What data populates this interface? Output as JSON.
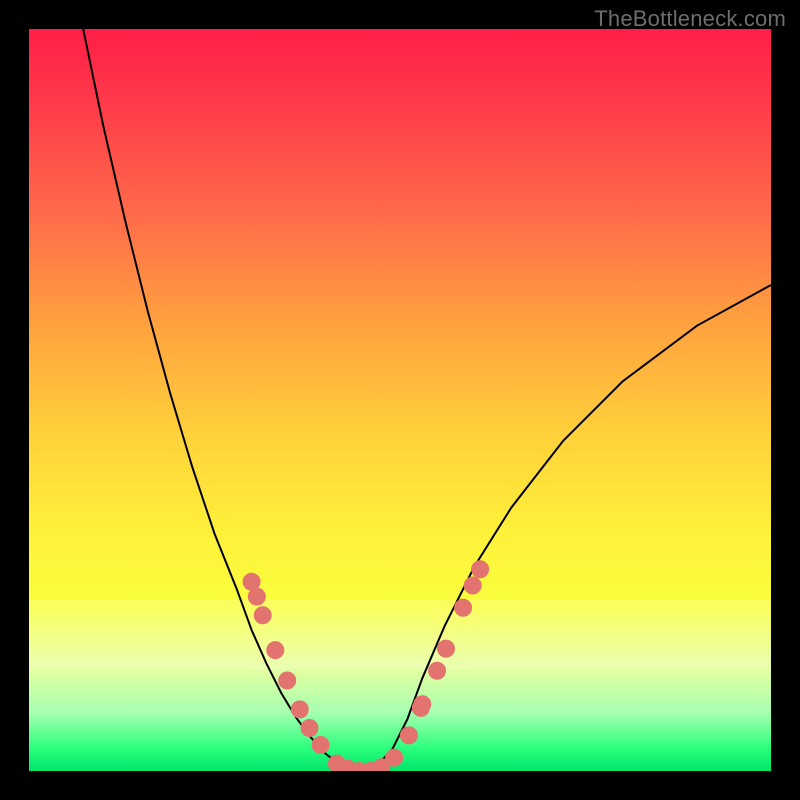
{
  "watermark": "TheBottleneck.com",
  "colors": {
    "frame": "#000000",
    "dot": "#e2736e",
    "line": "#000000"
  },
  "highlight_band": {
    "top_frac": 0.77,
    "height_frac": 0.092
  },
  "chart_data": {
    "type": "line",
    "title": "",
    "xlabel": "",
    "ylabel": "",
    "xlim": [
      0,
      1
    ],
    "ylim": [
      0,
      1
    ],
    "grid": false,
    "legend": false,
    "series": [
      {
        "name": "bottleneck-curve",
        "x": [
          0.073,
          0.1,
          0.13,
          0.16,
          0.19,
          0.22,
          0.25,
          0.28,
          0.3,
          0.32,
          0.34,
          0.36,
          0.38,
          0.4,
          0.42,
          0.435,
          0.45,
          0.47,
          0.49,
          0.51,
          0.53,
          0.56,
          0.6,
          0.65,
          0.72,
          0.8,
          0.9,
          1.0
        ],
        "y": [
          1.0,
          0.87,
          0.74,
          0.62,
          0.51,
          0.41,
          0.32,
          0.245,
          0.19,
          0.145,
          0.105,
          0.072,
          0.045,
          0.023,
          0.008,
          0.0,
          0.0,
          0.008,
          0.03,
          0.07,
          0.125,
          0.195,
          0.275,
          0.355,
          0.445,
          0.525,
          0.6,
          0.655
        ]
      }
    ],
    "markers": [
      {
        "x": 0.3,
        "y": 0.255
      },
      {
        "x": 0.307,
        "y": 0.235
      },
      {
        "x": 0.315,
        "y": 0.21
      },
      {
        "x": 0.332,
        "y": 0.163
      },
      {
        "x": 0.348,
        "y": 0.122
      },
      {
        "x": 0.365,
        "y": 0.083
      },
      {
        "x": 0.378,
        "y": 0.058
      },
      {
        "x": 0.393,
        "y": 0.035
      },
      {
        "x": 0.415,
        "y": 0.01
      },
      {
        "x": 0.43,
        "y": 0.003
      },
      {
        "x": 0.445,
        "y": 0.0
      },
      {
        "x": 0.46,
        "y": 0.0
      },
      {
        "x": 0.475,
        "y": 0.005
      },
      {
        "x": 0.492,
        "y": 0.018
      },
      {
        "x": 0.512,
        "y": 0.048
      },
      {
        "x": 0.528,
        "y": 0.085
      },
      {
        "x": 0.53,
        "y": 0.09
      },
      {
        "x": 0.55,
        "y": 0.135
      },
      {
        "x": 0.562,
        "y": 0.165
      },
      {
        "x": 0.585,
        "y": 0.22
      },
      {
        "x": 0.598,
        "y": 0.25
      },
      {
        "x": 0.608,
        "y": 0.272
      }
    ]
  }
}
